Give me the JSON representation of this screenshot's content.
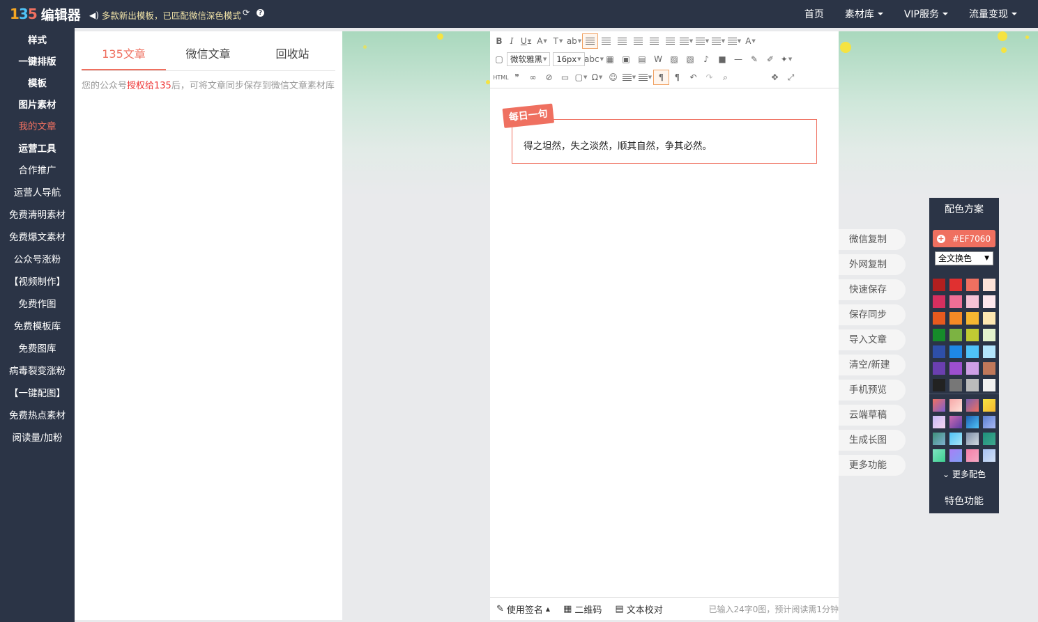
{
  "logo": {
    "mark_1": "1",
    "mark_2": "3",
    "mark_3": "5",
    "text": "编辑器"
  },
  "notice": "多款新出模板，已匹配微信深色模式",
  "topnav": [
    {
      "label": "首页",
      "dropdown": false
    },
    {
      "label": "素材库",
      "dropdown": true
    },
    {
      "label": "VIP服务",
      "dropdown": true
    },
    {
      "label": "流量变现",
      "dropdown": true
    }
  ],
  "sidebar": {
    "items": [
      {
        "label": "样式",
        "bold": true
      },
      {
        "label": "一键排版",
        "bold": true
      },
      {
        "label": "模板",
        "bold": true
      },
      {
        "label": "图片素材",
        "bold": true
      },
      {
        "label": "我的文章",
        "bold": false,
        "active": true
      },
      {
        "label": "运营工具",
        "bold": true
      },
      {
        "label": "合作推广"
      },
      {
        "label": "运营人导航"
      },
      {
        "label": "免费清明素材"
      },
      {
        "label": "免费爆文素材"
      },
      {
        "label": "公众号涨粉"
      },
      {
        "label": "【视频制作】"
      },
      {
        "label": "免费作图"
      },
      {
        "label": "免费模板库"
      },
      {
        "label": "免费图库"
      },
      {
        "label": "病毒裂变涨粉"
      },
      {
        "label": "【一键配图】"
      },
      {
        "label": "免费热点素材"
      },
      {
        "label": "阅读量/加粉"
      }
    ]
  },
  "panel": {
    "tabs": [
      "135文章",
      "微信文章",
      "回收站"
    ],
    "active_tab": 0,
    "note_before": "您的公众号",
    "note_link": "授权给135",
    "note_after": "后，可将文章同步保存到微信文章素材库"
  },
  "toolbar": {
    "font_family": "微软雅黑",
    "font_size": "16px",
    "html_label": "HTML"
  },
  "content": {
    "ribbon": "每日一句",
    "text": "得之坦然，失之淡然，顺其自然，争其必然。"
  },
  "statusbar": {
    "signature": "使用签名",
    "qrcode": "二维码",
    "proofread": "文本校对",
    "count": "已输入24字0图，预计阅读需1分钟"
  },
  "actions": [
    "微信复制",
    "外网复制",
    "快速保存",
    "保存同步",
    "导入文章",
    "清空/新建",
    "手机预览",
    "云端草稿",
    "生成长图",
    "更多功能"
  ],
  "color_panel": {
    "title": "配色方案",
    "current": "#EF7060",
    "mode": "全文换色",
    "solid": [
      "#b11f1f",
      "#e03030",
      "#ef7060",
      "#fde3d8",
      "#d62f5f",
      "#ef6f96",
      "#f5c3d5",
      "#fde7ec",
      "#e85a1e",
      "#f58a25",
      "#f5b731",
      "#fde7b1",
      "#168b2a",
      "#7cb342",
      "#c0ca33",
      "#e3f2cc",
      "#2e4fa8",
      "#1e88e5",
      "#4fc3f7",
      "#b3e5fc",
      "#6a3fb0",
      "#9c4fd0",
      "#ce9fe5",
      "#c0785a",
      "#222222",
      "#777777",
      "#bbbbbb",
      "#f0f0f0"
    ],
    "gradient": [
      [
        "#ef7060",
        "#7c5fd0"
      ],
      [
        "#f7a8a8",
        "#fde0d8"
      ],
      [
        "#7a5fb0",
        "#ef7060"
      ],
      [
        "#f5e342",
        "#f5b731"
      ],
      [
        "#c7b8f5",
        "#f5d6f0"
      ],
      [
        "#d06ab0",
        "#5a3fa8"
      ],
      [
        "#1e5fb0",
        "#4fc3f7"
      ],
      [
        "#5a7fd0",
        "#a8b8f5"
      ],
      [
        "#3e8f7a",
        "#7fb0d0"
      ],
      [
        "#4fc3f7",
        "#a8e5f5"
      ],
      [
        "#7f8fa8",
        "#d0d8e0"
      ],
      [
        "#1e8f7a",
        "#3ea88f"
      ],
      [
        "#7fe5c3",
        "#3ed090"
      ],
      [
        "#a87ff5",
        "#7f9ff5"
      ],
      [
        "#f57fa8",
        "#f5a8c3"
      ],
      [
        "#a8c3f5",
        "#d0e0f5"
      ]
    ],
    "more": "更多配色",
    "feature": "特色功能"
  }
}
